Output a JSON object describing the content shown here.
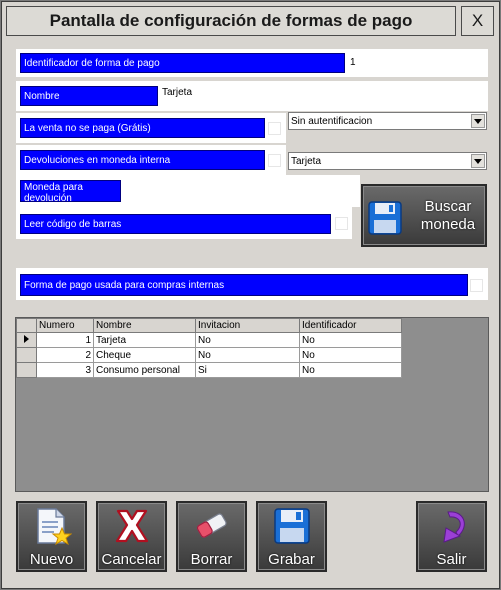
{
  "window": {
    "title": "Pantalla de configuración de formas de pago",
    "close_label": "X"
  },
  "form": {
    "id_label": "Identificador de forma de pago",
    "id_value": "1",
    "name_label": "Nombre",
    "name_value": "Tarjeta",
    "free_sale_label": "La venta no se paga (Grátis)",
    "auth_select": "Sin autentificacion",
    "internal_refund_label": "Devoluciones en moneda interna",
    "refund_select": "Tarjeta",
    "refund_currency_label": "Moneda para devolución",
    "barcode_label": "Leer código de barras",
    "internal_purchase_label": "Forma de pago usada para compras internas",
    "find_currency_label": "Buscar moneda"
  },
  "grid": {
    "columns": [
      "Numero",
      "Nombre",
      "Invitacion",
      "Identificador"
    ],
    "rows": [
      {
        "numero": "1",
        "nombre": "Tarjeta",
        "invitacion": "No",
        "identificador": "No"
      },
      {
        "numero": "2",
        "nombre": "Cheque",
        "invitacion": "No",
        "identificador": "No"
      },
      {
        "numero": "3",
        "nombre": "Consumo personal",
        "invitacion": "Si",
        "identificador": "No"
      }
    ]
  },
  "toolbar": {
    "new_label": "Nuevo",
    "cancel_label": "Cancelar",
    "delete_label": "Borrar",
    "save_label": "Grabar",
    "exit_label": "Salir"
  },
  "colors": {
    "label_bg": "#0000ff",
    "window_bg": "#d8d5d0",
    "button_bg": "#4a4a4a"
  }
}
